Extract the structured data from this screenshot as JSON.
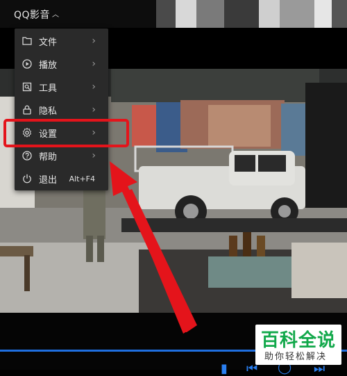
{
  "app": {
    "title": "QQ影音"
  },
  "menu": {
    "items": [
      {
        "label": "文件",
        "icon": "folder-icon",
        "has_submenu": true
      },
      {
        "label": "播放",
        "icon": "play-circle-icon",
        "has_submenu": true
      },
      {
        "label": "工具",
        "icon": "tools-icon",
        "has_submenu": true
      },
      {
        "label": "隐私",
        "icon": "lock-icon",
        "has_submenu": true
      },
      {
        "label": "设置",
        "icon": "gear-icon",
        "has_submenu": true
      },
      {
        "label": "帮助",
        "icon": "help-icon",
        "has_submenu": true
      },
      {
        "label": "退出",
        "icon": "power-icon",
        "shortcut": "Alt+F4"
      }
    ]
  },
  "annotation": {
    "highlight_color": "#e4141b"
  },
  "watermark": {
    "main": "百科全说",
    "sub": "助你轻松解决",
    "color": "#11a84a"
  },
  "colors": {
    "menu_bg": "#2a2a2a",
    "accent": "#2a7ff0"
  }
}
